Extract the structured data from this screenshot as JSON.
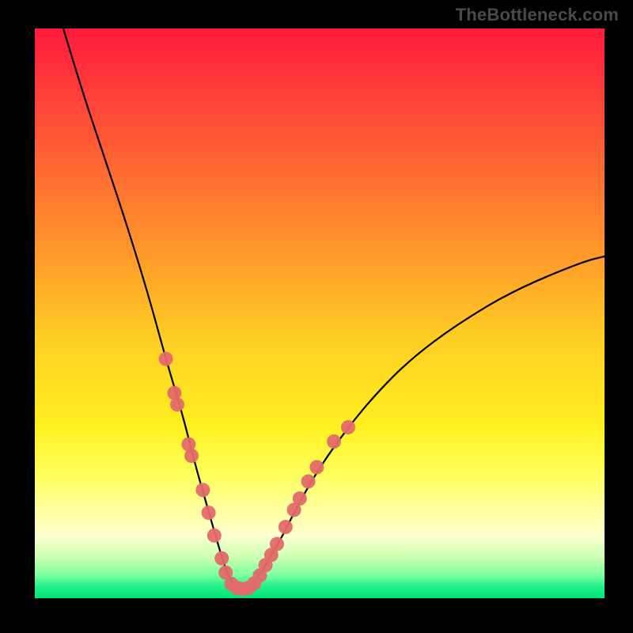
{
  "attribution": "TheBottleneck.com",
  "chart_data": {
    "type": "line",
    "title": "",
    "xlabel": "",
    "ylabel": "",
    "xlim": [
      0,
      100
    ],
    "ylim": [
      0,
      100
    ],
    "series": [
      {
        "name": "bottleneck-curve",
        "x": [
          5,
          8,
          12,
          16,
          20,
          23,
          26,
          28,
          30,
          32,
          33.5,
          35,
          36.5,
          38,
          40,
          43,
          46,
          50,
          55,
          60,
          66,
          74,
          84,
          96,
          100
        ],
        "y": [
          100,
          90,
          78,
          66,
          53,
          42,
          32,
          24,
          17,
          10,
          5,
          2,
          1.5,
          2,
          5,
          10,
          16,
          23,
          30,
          36,
          42,
          48,
          54,
          59,
          60
        ]
      }
    ],
    "markers": [
      {
        "name": "left-cluster",
        "color": "#e46a6a",
        "points": [
          {
            "x": 23.0,
            "y": 42
          },
          {
            "x": 24.5,
            "y": 36
          },
          {
            "x": 25.0,
            "y": 34
          },
          {
            "x": 27.0,
            "y": 27
          },
          {
            "x": 27.5,
            "y": 25
          },
          {
            "x": 29.5,
            "y": 19
          },
          {
            "x": 30.5,
            "y": 15
          },
          {
            "x": 31.5,
            "y": 11
          },
          {
            "x": 32.8,
            "y": 7
          }
        ]
      },
      {
        "name": "bottom-cluster",
        "color": "#e46a6a",
        "points": [
          {
            "x": 33.5,
            "y": 4.5
          },
          {
            "x": 34.5,
            "y": 2.5
          },
          {
            "x": 35.5,
            "y": 1.8
          },
          {
            "x": 36.5,
            "y": 1.6
          },
          {
            "x": 37.5,
            "y": 1.8
          },
          {
            "x": 38.5,
            "y": 2.6
          },
          {
            "x": 39.5,
            "y": 4.0
          },
          {
            "x": 40.5,
            "y": 5.8
          },
          {
            "x": 41.5,
            "y": 7.6
          }
        ]
      },
      {
        "name": "right-cluster",
        "color": "#e46a6a",
        "points": [
          {
            "x": 42.5,
            "y": 9.5
          },
          {
            "x": 44.0,
            "y": 12.5
          },
          {
            "x": 45.5,
            "y": 15.5
          },
          {
            "x": 46.5,
            "y": 17.5
          },
          {
            "x": 48.0,
            "y": 20.5
          },
          {
            "x": 49.5,
            "y": 23.0
          },
          {
            "x": 52.5,
            "y": 27.5
          },
          {
            "x": 55.0,
            "y": 30.0
          }
        ]
      }
    ]
  }
}
